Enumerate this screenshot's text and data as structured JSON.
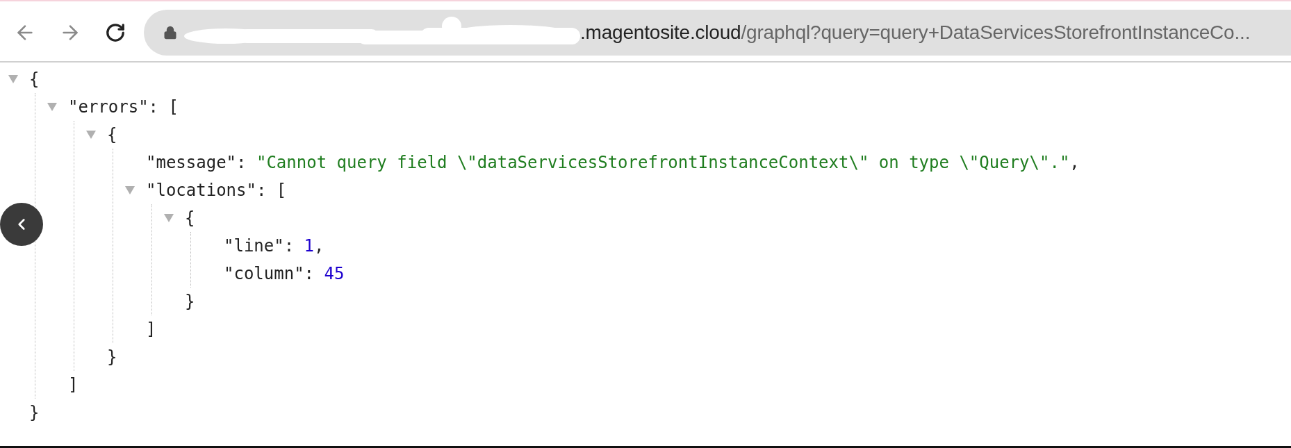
{
  "toolbar": {
    "back": {
      "disabled": true
    },
    "forward": {
      "disabled": true
    },
    "reload": {
      "disabled": false
    }
  },
  "address_bar": {
    "host": ".magentosite.cloud",
    "path": "/graphql?query=query+DataServicesStorefrontInstanceCo..."
  },
  "json_viewer": {
    "root": {
      "kind": "branch",
      "open": "{",
      "close": "}",
      "expanded": true,
      "children": [
        {
          "kind": "branch",
          "key": "\"errors\"",
          "colon": ":",
          "open": "[",
          "close": "]",
          "expanded": true,
          "children": [
            {
              "kind": "branch",
              "open": "{",
              "close": "}",
              "expanded": true,
              "children": [
                {
                  "kind": "string",
                  "key": "\"message\"",
                  "colon": ":",
                  "value": "\"Cannot query field \\\"dataServicesStorefrontInstanceContext\\\" on type \\\"Query\\\".\"",
                  "comma": ","
                },
                {
                  "kind": "branch",
                  "key": "\"locations\"",
                  "colon": ":",
                  "open": "[",
                  "close": "]",
                  "expanded": true,
                  "children": [
                    {
                      "kind": "branch",
                      "open": "{",
                      "close": "}",
                      "expanded": true,
                      "children": [
                        {
                          "kind": "number",
                          "key": "\"line\"",
                          "colon": ":",
                          "value": "1",
                          "comma": ","
                        },
                        {
                          "kind": "number",
                          "key": "\"column\"",
                          "colon": ":",
                          "value": "45"
                        }
                      ]
                    }
                  ]
                }
              ]
            }
          ]
        }
      ]
    }
  }
}
